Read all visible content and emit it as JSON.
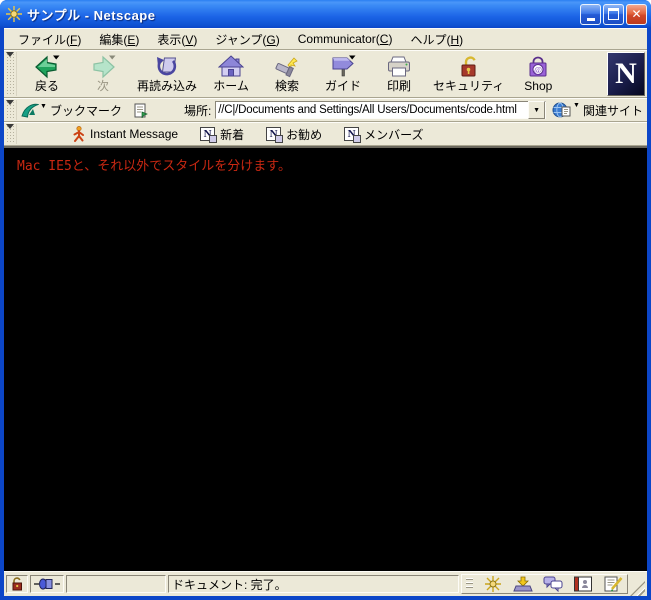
{
  "window": {
    "title": "サンプル - Netscape"
  },
  "menubar": {
    "items": [
      {
        "pre": "ファイル(",
        "key": "F",
        "post": ")"
      },
      {
        "pre": "編集(",
        "key": "E",
        "post": ")"
      },
      {
        "pre": "表示(",
        "key": "V",
        "post": ")"
      },
      {
        "pre": "ジャンプ(",
        "key": "G",
        "post": ")"
      },
      {
        "pre": "Communicator(",
        "key": "C",
        "post": ")"
      },
      {
        "pre": "ヘルプ(",
        "key": "H",
        "post": ")"
      }
    ]
  },
  "toolbar": {
    "buttons": [
      {
        "label": "戻る"
      },
      {
        "label": "次"
      },
      {
        "label": "再読み込み"
      },
      {
        "label": "ホーム"
      },
      {
        "label": "検索"
      },
      {
        "label": "ガイド"
      },
      {
        "label": "印刷"
      },
      {
        "label": "セキュリティ"
      },
      {
        "label": "Shop"
      }
    ],
    "logo_letter": "N"
  },
  "locationbar": {
    "bookmarks_label": "ブックマーク",
    "location_label": "場所:",
    "url": "//C|/Documents and Settings/All Users/Documents/code.html",
    "related_label": "関連サイト"
  },
  "personalbar": {
    "n_badge_letter": "N",
    "items": [
      {
        "label": "Instant Message"
      },
      {
        "label": "新着"
      },
      {
        "label": "お勧め"
      },
      {
        "label": "メンバーズ"
      }
    ]
  },
  "content": {
    "message": "Mac IE5と、それ以外でスタイルを分けます。",
    "background": "#000000",
    "message_color": "#c92812"
  },
  "statusbar": {
    "status": "ドキュメント: 完了。"
  },
  "colors": {
    "chrome": "#ece9d8",
    "titlebar_blue": "#1b63e6",
    "back_green": "#1fa35c",
    "close_red": "#d0482a"
  }
}
